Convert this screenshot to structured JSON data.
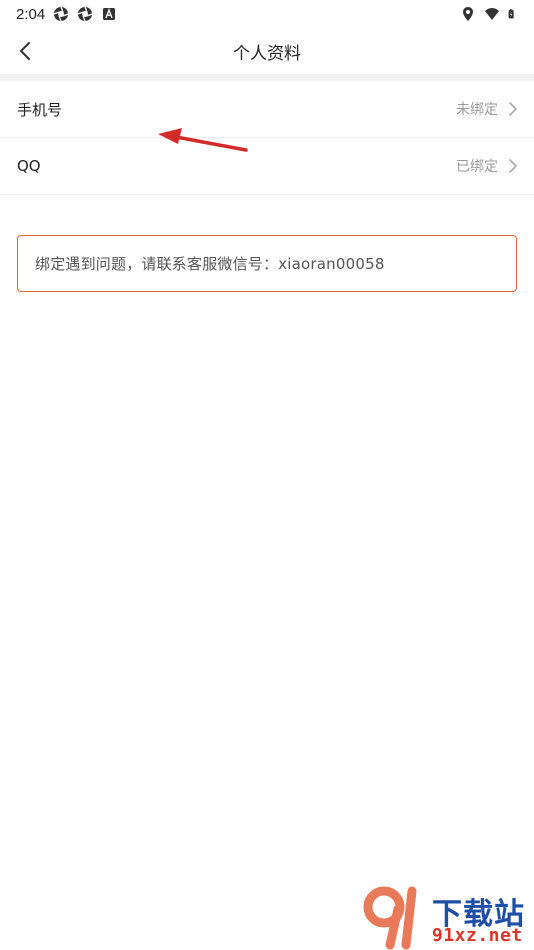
{
  "status_bar": {
    "time": "2:04",
    "left_icons": [
      "aperture-icon",
      "aperture-icon",
      "a-badge-icon"
    ],
    "right_icons": [
      "location-icon",
      "wifi-icon",
      "battery-charging-icon"
    ]
  },
  "header": {
    "title": "个人资料",
    "back_icon": "chevron-left-icon"
  },
  "rows": [
    {
      "label": "手机号",
      "value": "未绑定"
    },
    {
      "label": "QQ",
      "value": "已绑定"
    }
  ],
  "notice": {
    "text": "绑定遇到问题，请联系客服微信号：xiaoran00058"
  },
  "colors": {
    "notice_border": "#e8643c",
    "arrow": "#d42a2a",
    "value_text": "#9a9a9a",
    "divider": "#f2f2f2"
  },
  "watermark": {
    "cn": "下载站",
    "url": "91xz.net"
  }
}
